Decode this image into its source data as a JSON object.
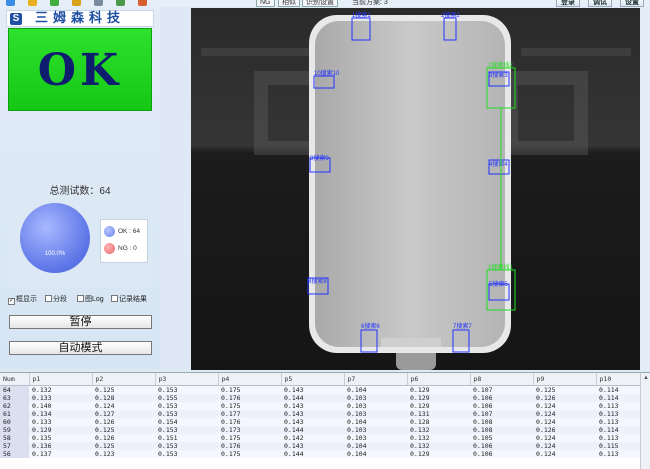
{
  "toolbar": {
    "tabs": [
      "NG",
      "相似",
      "识别设置"
    ],
    "status_text": "当前方案: 3",
    "buttons": [
      "登录",
      "调试",
      "设置"
    ],
    "icon_colors": [
      "#3a8ee6",
      "#e8b020",
      "#3fae3f",
      "#d9a21c",
      "#7a8ba0",
      "#4b9a4b",
      "#d86030"
    ]
  },
  "left_panel": {
    "logo_icon": "S",
    "logo_text": "三姆森科技",
    "result": "OK",
    "result_color": "#1ccf1c",
    "total_tests_label": "总测试数：64",
    "pie_percent": "100.0%",
    "ok_ratio": 1.0,
    "legend": [
      {
        "label": "OK : 64",
        "color": "#6b85ee"
      },
      {
        "label": "NG : 0",
        "color": "#e86a6a"
      }
    ],
    "options": [
      {
        "label": "框显示",
        "checked": true
      },
      {
        "label": "分段",
        "checked": false
      },
      {
        "label": "图Log",
        "checked": false
      },
      {
        "label": "记录结果",
        "checked": false
      }
    ],
    "pause_button": "暂停",
    "auto_mode_button": "自动模式"
  },
  "camera_view": {
    "roi_labels": [
      "1搜索1",
      "2搜索2",
      "3搜索3",
      "4搜索4",
      "5搜索5",
      "6搜索6",
      "7搜索7",
      "8搜索8",
      "9搜索9",
      "10搜索10"
    ],
    "green_labels": [
      "1搜索线2",
      "1搜索线1"
    ]
  },
  "table": {
    "columns": [
      "Num",
      "p1",
      "p2",
      "p3",
      "p4",
      "p5",
      "p7",
      "p6",
      "p8",
      "p9",
      "p10"
    ],
    "rows": [
      [
        "64",
        "0.132",
        "0.125",
        "0.153",
        "0.175",
        "0.143",
        "0.104",
        "0.129",
        "0.107",
        "0.125",
        "0.114"
      ],
      [
        "63",
        "0.133",
        "0.128",
        "0.155",
        "0.176",
        "0.144",
        "0.103",
        "0.129",
        "0.106",
        "0.126",
        "0.114"
      ],
      [
        "62",
        "0.140",
        "0.124",
        "0.153",
        "0.175",
        "0.143",
        "0.103",
        "0.129",
        "0.106",
        "0.124",
        "0.113"
      ],
      [
        "61",
        "0.134",
        "0.127",
        "0.153",
        "0.177",
        "0.143",
        "0.103",
        "0.131",
        "0.107",
        "0.124",
        "0.113"
      ],
      [
        "60",
        "0.133",
        "0.126",
        "0.154",
        "0.176",
        "0.143",
        "0.104",
        "0.128",
        "0.108",
        "0.124",
        "0.113"
      ],
      [
        "59",
        "0.129",
        "0.125",
        "0.153",
        "0.173",
        "0.144",
        "0.103",
        "0.132",
        "0.108",
        "0.126",
        "0.114"
      ],
      [
        "58",
        "0.135",
        "0.126",
        "0.151",
        "0.175",
        "0.142",
        "0.103",
        "0.132",
        "0.105",
        "0.124",
        "0.113"
      ],
      [
        "57",
        "0.136",
        "0.125",
        "0.153",
        "0.176",
        "0.143",
        "0.104",
        "0.132",
        "0.106",
        "0.124",
        "0.115"
      ],
      [
        "56",
        "0.137",
        "0.123",
        "0.153",
        "0.175",
        "0.144",
        "0.104",
        "0.129",
        "0.106",
        "0.124",
        "0.113"
      ]
    ]
  }
}
